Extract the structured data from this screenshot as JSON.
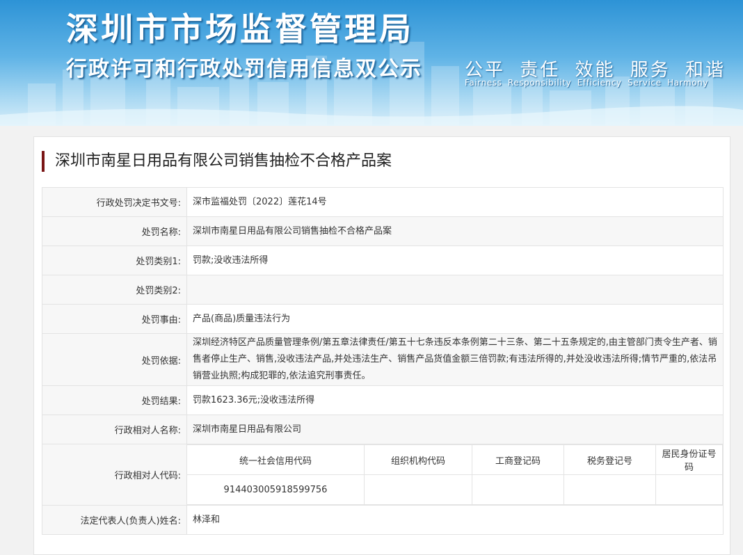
{
  "banner": {
    "title": "深圳市市场监督管理局",
    "subtitle": "行政许可和行政处罚信用信息双公示",
    "slogan": "公平 责任 效能 服务 和谐",
    "slogan_en": "Fairness Responsibility Efficiency Service Harmony"
  },
  "case_title": "深圳市南星日用品有限公司销售抽检不合格产品案",
  "rows": {
    "doc_no": {
      "label": "行政处罚决定书文号:",
      "value": "深市监福处罚〔2022〕莲花14号"
    },
    "name": {
      "label": "处罚名称:",
      "value": "深圳市南星日用品有限公司销售抽检不合格产品案"
    },
    "type1": {
      "label": "处罚类别1:",
      "value": "罚款;没收违法所得"
    },
    "type2": {
      "label": "处罚类别2:",
      "value": ""
    },
    "reason": {
      "label": "处罚事由:",
      "value": "产品(商品)质量违法行为"
    },
    "basis": {
      "label": "处罚依据:",
      "value": "深圳经济特区产品质量管理条例/第五章法律责任/第五十七条违反本条例第二十三条、第二十五条规定的,由主管部门责令生产者、销售者停止生产、销售,没收违法产品,并处违法生产、销售产品货值金额三倍罚款;有违法所得的,并处没收违法所得;情节严重的,依法吊销营业执照;构成犯罪的,依法追究刑事责任。"
    },
    "result": {
      "label": "处罚结果:",
      "value": "罚款1623.36元;没收违法所得"
    },
    "party": {
      "label": "行政相对人名称:",
      "value": "深圳市南星日用品有限公司"
    },
    "codes": {
      "label": "行政相对人代码:",
      "headers": [
        "统一社会信用代码",
        "组织机构代码",
        "工商登记码",
        "税务登记号",
        "居民身份证号码"
      ],
      "values": [
        "914403005918599756",
        "",
        "",
        "",
        ""
      ]
    },
    "legal_rep": {
      "label": "法定代表人(负责人)姓名:",
      "value": "林泽和"
    }
  }
}
